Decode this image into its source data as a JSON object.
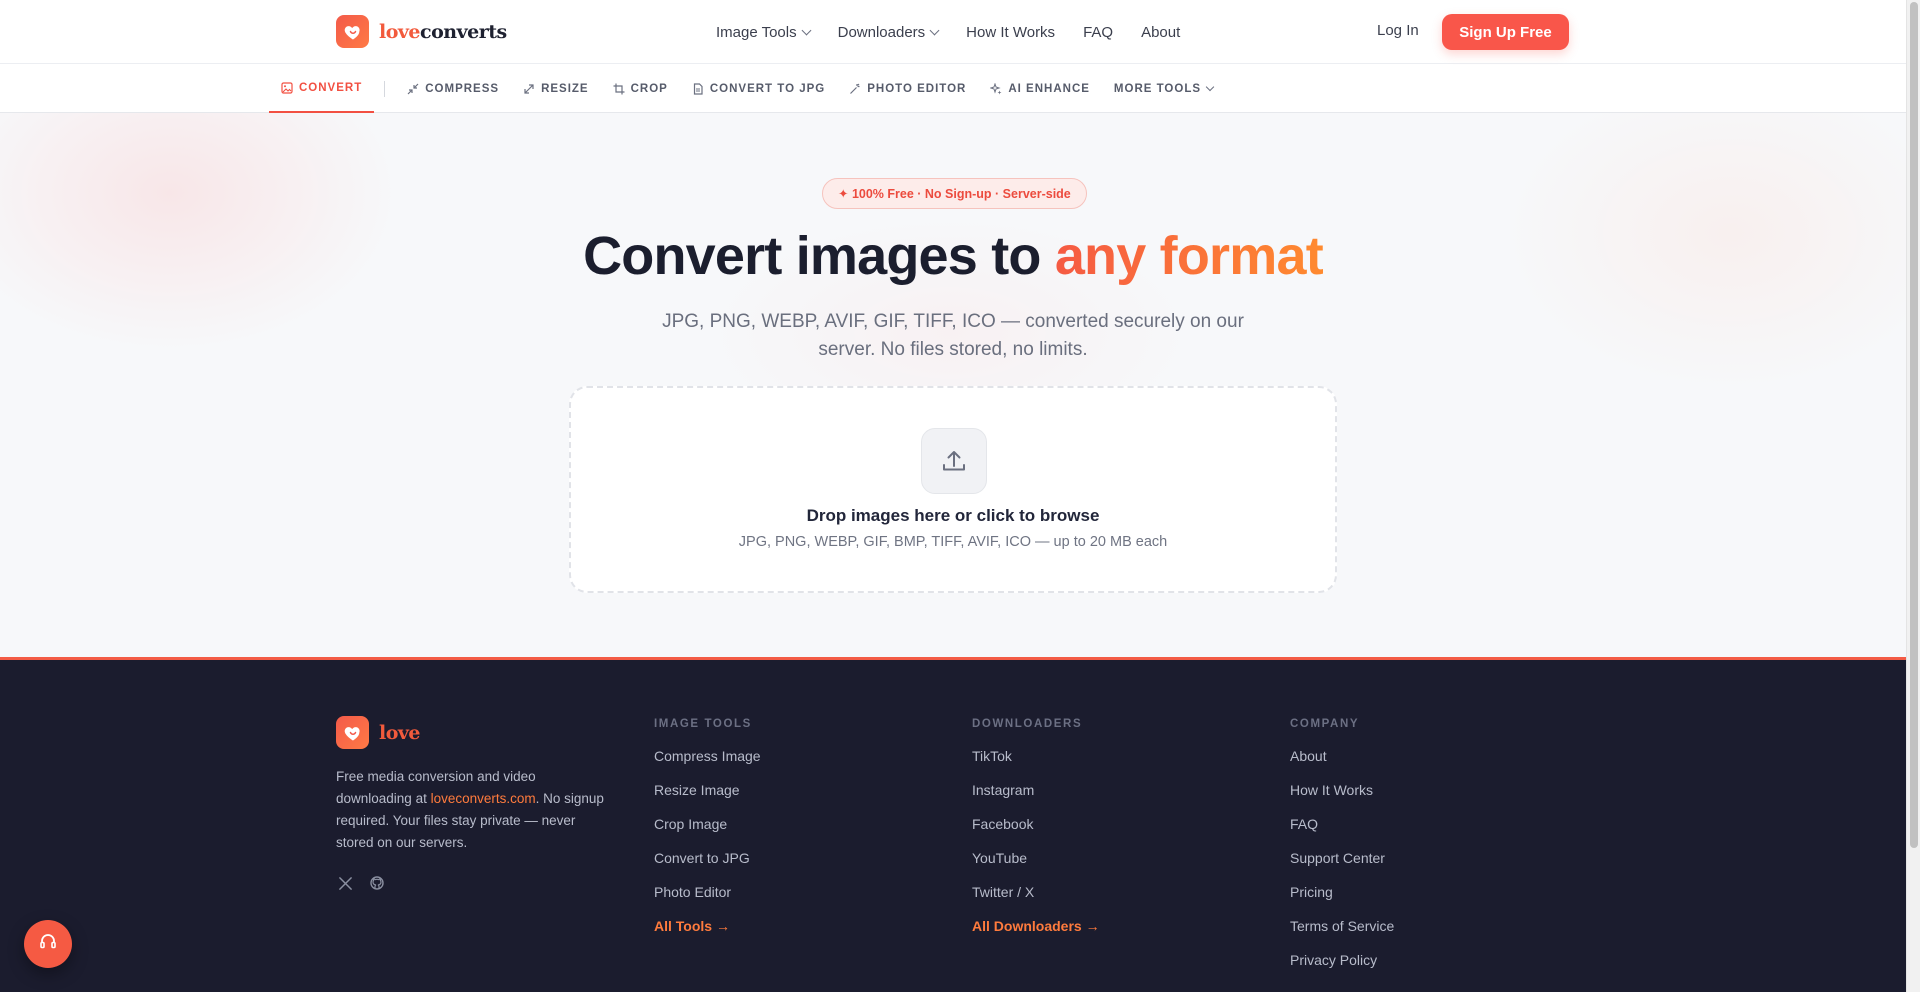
{
  "brand": {
    "name_part1": "love",
    "name_part2": "converts",
    "footer_name": "love"
  },
  "header": {
    "nav": [
      {
        "label": "Image Tools",
        "has_dropdown": true
      },
      {
        "label": "Downloaders",
        "has_dropdown": true
      },
      {
        "label": "How It Works",
        "has_dropdown": false
      },
      {
        "label": "FAQ",
        "has_dropdown": false
      },
      {
        "label": "About",
        "has_dropdown": false
      }
    ],
    "login_label": "Log In",
    "signup_label": "Sign Up Free"
  },
  "toolbar": {
    "items": [
      {
        "label": "CONVERT",
        "icon": "image-icon",
        "active": true
      },
      {
        "label": "COMPRESS",
        "icon": "compress-icon",
        "active": false
      },
      {
        "label": "RESIZE",
        "icon": "resize-icon",
        "active": false
      },
      {
        "label": "CROP",
        "icon": "crop-icon",
        "active": false
      },
      {
        "label": "CONVERT TO JPG",
        "icon": "file-icon",
        "active": false
      },
      {
        "label": "PHOTO EDITOR",
        "icon": "wand-icon",
        "active": false
      },
      {
        "label": "AI ENHANCE",
        "icon": "sparkle-icon",
        "active": false
      }
    ],
    "more_label": "MORE TOOLS"
  },
  "hero": {
    "badge": "✦ 100% Free · No Sign-up · Server-side",
    "headline_main": "Convert images to ",
    "headline_accent": "any format",
    "subtitle": "JPG, PNG, WEBP, AVIF, GIF, TIFF, ICO — converted securely on our server. No files stored, no limits.",
    "dropzone_title": "Drop images here or click to browse",
    "dropzone_formats": "JPG, PNG, WEBP, GIF, BMP, TIFF, AVIF, ICO — up to 20 MB each"
  },
  "footer": {
    "description_before": "Free media conversion and video downloading at ",
    "description_link": "loveconverts.com",
    "description_after": ". No signup required. Your files stay private — never stored on our servers.",
    "columns": [
      {
        "title": "IMAGE TOOLS",
        "links": [
          "Compress Image",
          "Resize Image",
          "Crop Image",
          "Convert to JPG",
          "Photo Editor"
        ],
        "cta": "All Tools →"
      },
      {
        "title": "DOWNLOADERS",
        "links": [
          "TikTok",
          "Instagram",
          "Facebook",
          "YouTube",
          "Twitter / X"
        ],
        "cta": "All Downloaders →"
      },
      {
        "title": "COMPANY",
        "links": [
          "About",
          "How It Works",
          "FAQ",
          "Support Center",
          "Pricing",
          "Terms of Service",
          "Privacy Policy"
        ],
        "cta": ""
      }
    ]
  },
  "colors": {
    "accent": "#f9564a",
    "accent_orange": "#ff7b3d",
    "footer_bg": "#1b1c2e"
  }
}
